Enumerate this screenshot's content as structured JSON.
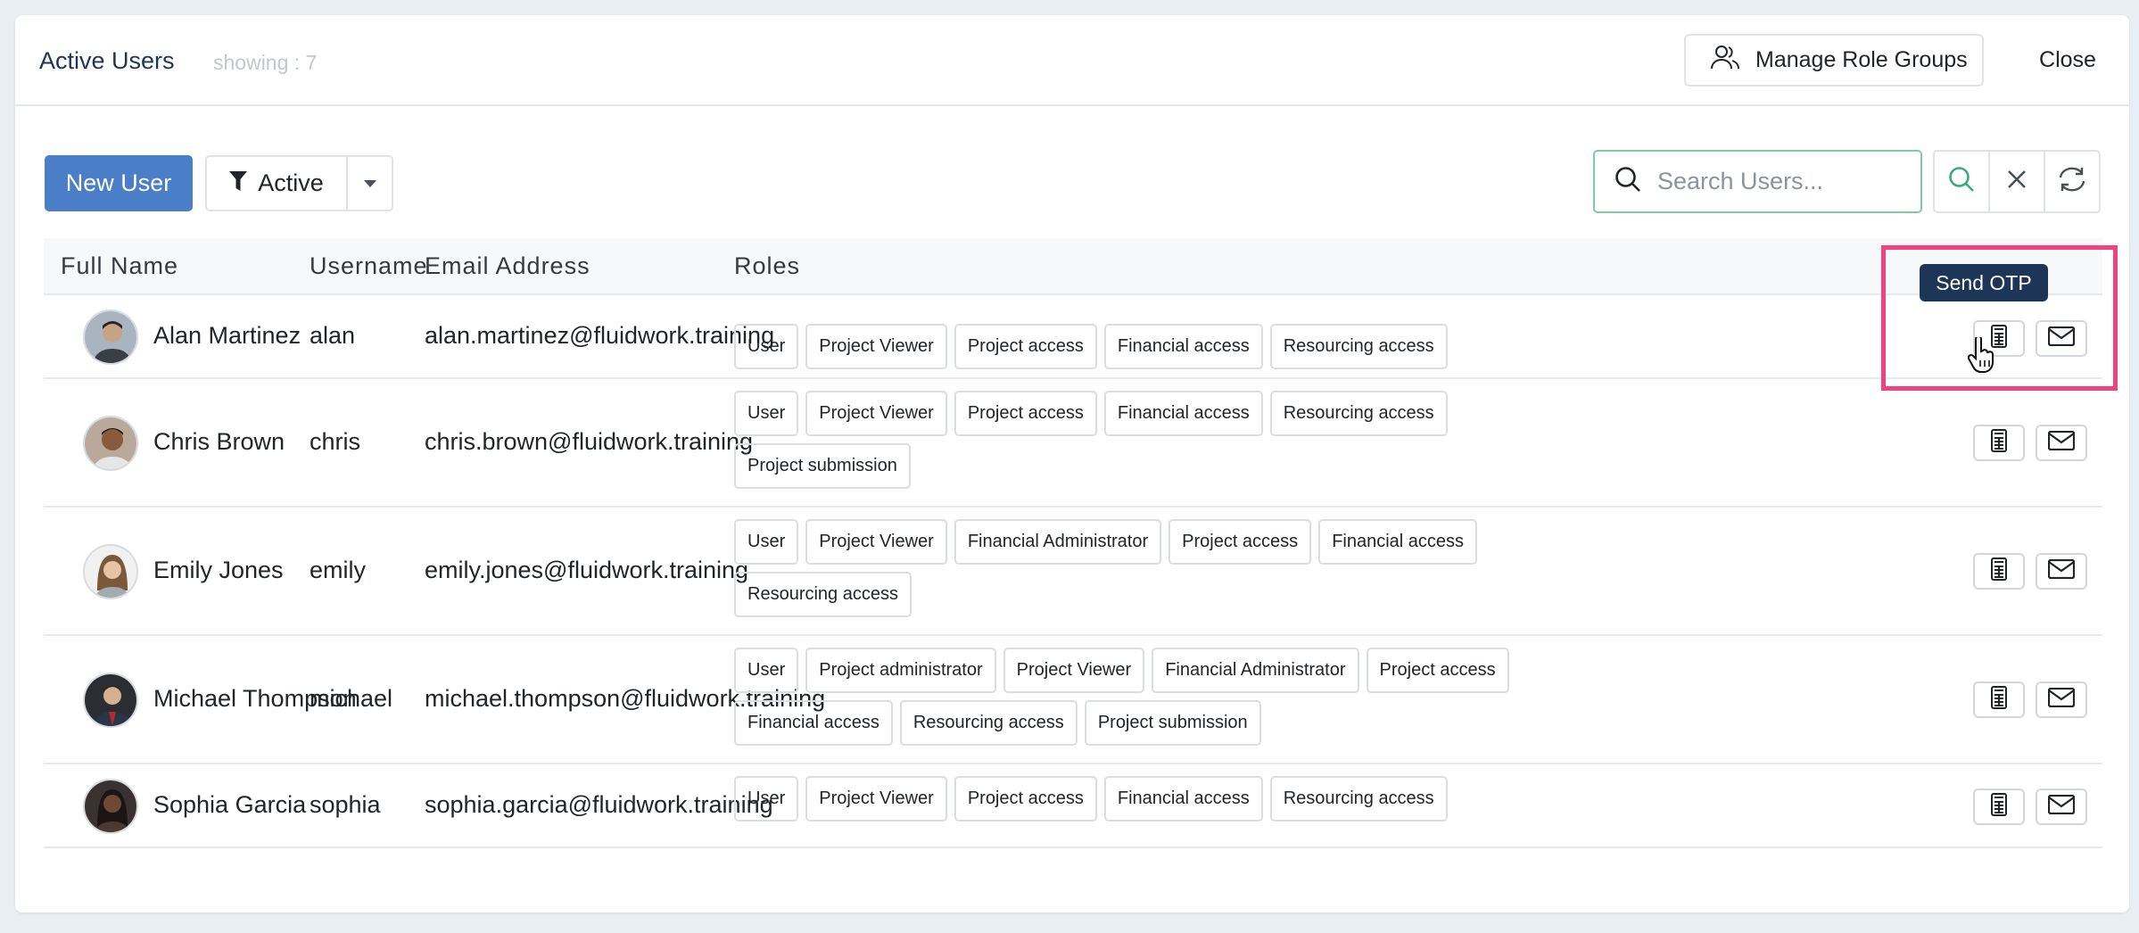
{
  "header": {
    "title": "Active Users",
    "showing": "showing : 7",
    "manage_role_groups": "Manage Role Groups",
    "close": "Close"
  },
  "toolbar": {
    "new_user": "New User",
    "filter_label": "Active",
    "search_placeholder": "Search Users..."
  },
  "table": {
    "columns": [
      "Full Name",
      "Username",
      "Email Address",
      "Roles"
    ],
    "rows": [
      {
        "full_name": "Alan Martinez",
        "username": "alan",
        "email": "alan.martinez@fluidwork.training",
        "roles": [
          "User",
          "Project Viewer",
          "Project access",
          "Financial access",
          "Resourcing access"
        ]
      },
      {
        "full_name": "Chris Brown",
        "username": "chris",
        "email": "chris.brown@fluidwork.training",
        "roles": [
          "User",
          "Project Viewer",
          "Project access",
          "Financial access",
          "Resourcing access",
          "Project submission"
        ]
      },
      {
        "full_name": "Emily Jones",
        "username": "emily",
        "email": "emily.jones@fluidwork.training",
        "roles": [
          "User",
          "Project Viewer",
          "Financial Administrator",
          "Project access",
          "Financial access",
          "Resourcing access"
        ]
      },
      {
        "full_name": "Michael Thompson",
        "username": "michael",
        "email": "michael.thompson@fluidwork.training",
        "roles": [
          "User",
          "Project administrator",
          "Project Viewer",
          "Financial Administrator",
          "Project access",
          "Financial access",
          "Resourcing access",
          "Project submission"
        ]
      },
      {
        "full_name": "Sophia Garcia",
        "username": "sophia",
        "email": "sophia.garcia@fluidwork.training",
        "roles": [
          "User",
          "Project Viewer",
          "Project access",
          "Financial access",
          "Resourcing access"
        ]
      }
    ]
  },
  "tooltip": "Send OTP",
  "colors": {
    "primary": "#4a7fc8",
    "title": "#1d3557",
    "search_border": "#7fc9a7",
    "highlight": "#f0427c",
    "tooltip_bg": "#1d3557"
  },
  "icons": {
    "manage_role_groups": "users-icon",
    "filter": "funnel-icon",
    "search": "search-icon",
    "clear": "close-icon",
    "refresh": "refresh-icon",
    "send_otp": "calculator-icon",
    "email": "envelope-icon"
  }
}
